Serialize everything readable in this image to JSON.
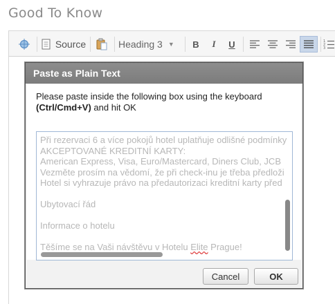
{
  "page": {
    "title": "Good To Know"
  },
  "toolbar": {
    "source_label": "Source",
    "format_label": "Heading 3",
    "bold_label": "B",
    "italic_label": "I",
    "underline_label": "U"
  },
  "dialog": {
    "title": "Paste as Plain Text",
    "instruction_prefix": "Please paste inside the following box using the keyboard",
    "shortcut": "(Ctrl/Cmd+V)",
    "instruction_suffix": " and hit OK",
    "pasted_lines": [
      "Při rezervaci 6 a více pokojů hotel uplatňuje odlišné podmínky",
      "AKCEPTOVANÉ KREDITNÍ KARTY:",
      "American Express, Visa, Euro/Mastercard, Diners Club, JCB",
      "Vezměte prosím na vědomí, že při check-inu je třeba předloži",
      "Hotel si vyhrazuje právo na předautorizaci kreditní karty před",
      "",
      "Ubytovací řád",
      "",
      "Informace o hotelu",
      "",
      "Těšíme se na Vaši návštěvu v Hotelu "
    ],
    "last_line_spellword": "Elite",
    "last_line_tail": " Prague!",
    "cancel_label": "Cancel",
    "ok_label": "OK"
  },
  "colors": {
    "dialog_header": "#858585",
    "paste_text": "#b7b7b7",
    "page_title": "#8a8a8a"
  }
}
